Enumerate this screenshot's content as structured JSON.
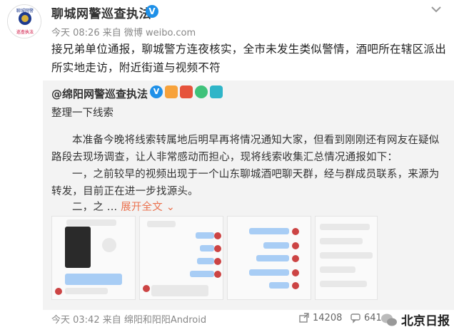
{
  "post": {
    "author": "聊城网警巡查执法",
    "meta": "今天 08:26 来自 微博 weibo.com",
    "text": "接兄弟单位通报，聊城警方连夜核实，全市未发生类似警情，酒吧所在辖区派出所实地走访，附近街道与视频不符"
  },
  "repost": {
    "author": "@绵阳网警巡查执法",
    "subtitle": "整理一下线索",
    "para1": "本准备今晚将线索转属地后明早再将情况通知大家，但看到刚刚还有网友在疑似路段去现场调查，让人非常感动而担心，现将线索收集汇总情况通报如下：",
    "para2": "一，之前较早的视频出现于一个山东聊城酒吧聊天群，经与群成员联系，来源为转发，目前正在进一步找源头。",
    "para3_prefix": "二，之 ...",
    "expand_label": "展开全文",
    "expand_chevron": "chevron-down-icon"
  },
  "footer": {
    "meta": "今天 03:42 来自 绵阳和阳阳Android",
    "share_count": "14208",
    "comment_count": "641",
    "watermark": "北京日报"
  },
  "colors": {
    "link": "#eb7350",
    "verify": "#1e90e8",
    "repost_bg": "#f3f3f3"
  }
}
